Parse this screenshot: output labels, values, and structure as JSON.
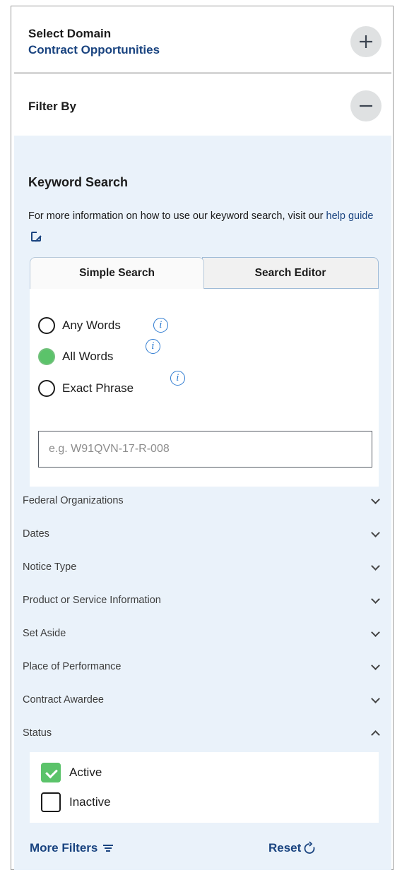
{
  "domain": {
    "label": "Select Domain",
    "value": "Contract Opportunities",
    "toggle_icon": "plus-icon"
  },
  "filter_by": {
    "label": "Filter By",
    "toggle_icon": "minus-icon"
  },
  "keyword_search": {
    "title": "Keyword Search",
    "help_text": "For more information on how to use our keyword search, visit our",
    "help_link": "help guide",
    "tabs": [
      {
        "label": "Simple Search",
        "active": true
      },
      {
        "label": "Search Editor",
        "active": false
      }
    ],
    "match_options": [
      {
        "label": "Any Words",
        "selected": false
      },
      {
        "label": "All Words",
        "selected": true
      },
      {
        "label": "Exact Phrase",
        "selected": false
      }
    ],
    "input": {
      "placeholder": "e.g. W91QVN-17-R-008",
      "value": ""
    }
  },
  "accordions": [
    {
      "label": "Federal Organizations",
      "expanded": false
    },
    {
      "label": "Dates",
      "expanded": false
    },
    {
      "label": "Notice Type",
      "expanded": false
    },
    {
      "label": "Product or Service Information",
      "expanded": false
    },
    {
      "label": "Set Aside",
      "expanded": false
    },
    {
      "label": "Place of Performance",
      "expanded": false
    },
    {
      "label": "Contract Awardee",
      "expanded": false
    },
    {
      "label": "Status",
      "expanded": true
    }
  ],
  "status_options": [
    {
      "label": "Active",
      "checked": true
    },
    {
      "label": "Inactive",
      "checked": false
    }
  ],
  "footer": {
    "more_filters": "More Filters",
    "reset": "Reset"
  },
  "colors": {
    "accent": "#1a4480",
    "panel_bg": "#eaf2fa",
    "selected_green": "#5bc36a",
    "info_blue": "#2e7bd1"
  }
}
